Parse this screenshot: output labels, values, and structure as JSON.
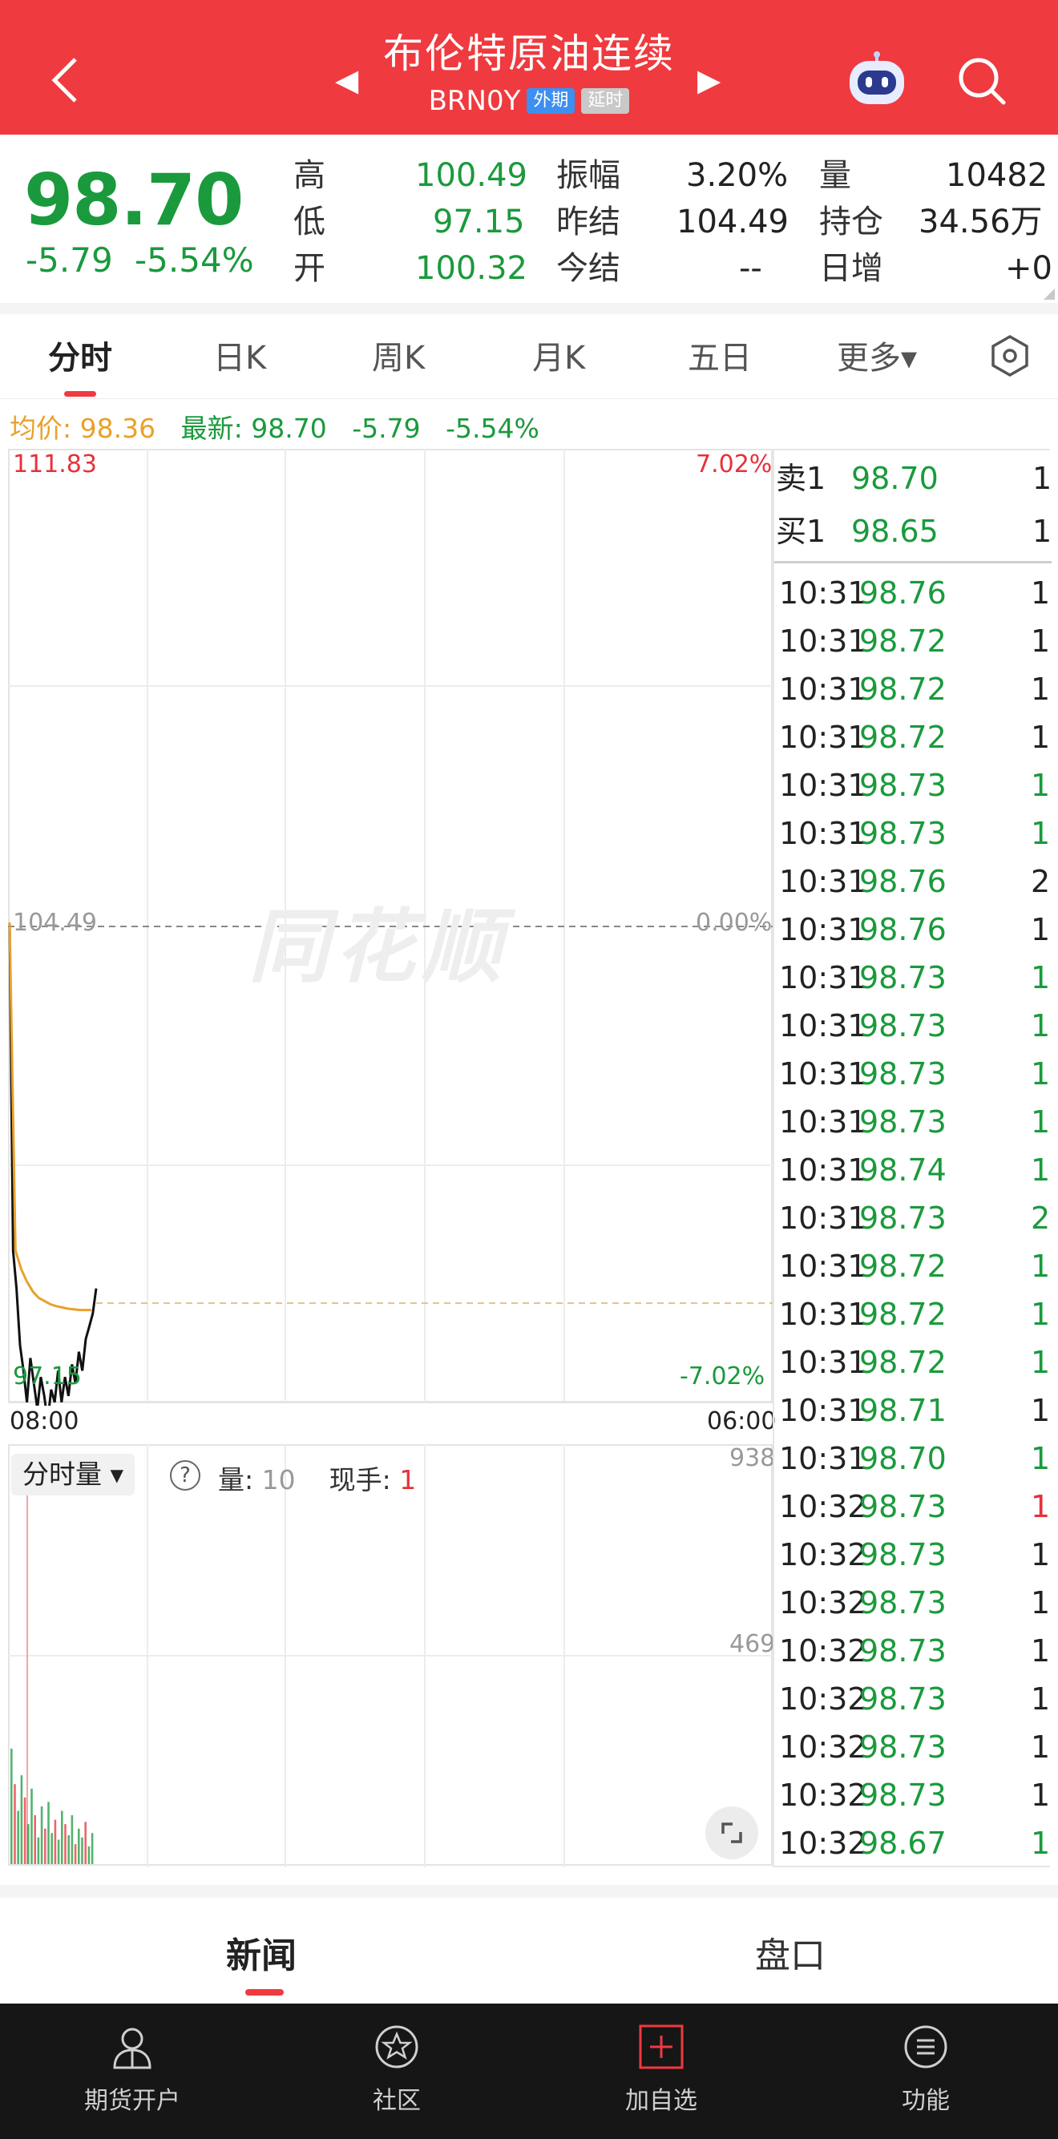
{
  "header": {
    "title": "布伦特原油连续",
    "code": "BRN0Y",
    "tag_foreign": "外期",
    "tag_delay": "延时",
    "arrow_left": "◀",
    "arrow_right": "▶"
  },
  "quote": {
    "price": "98.70",
    "change": "-5.79",
    "change_pct": "-5.54%",
    "high_label": "高",
    "high": "100.49",
    "low_label": "低",
    "low": "97.15",
    "open_label": "开",
    "open": "100.32",
    "amp_label": "振幅",
    "amp": "3.20%",
    "prev_settle_label": "昨结",
    "prev_settle": "104.49",
    "settle_label": "今结",
    "settle": "--",
    "vol_label": "量",
    "vol": "10482",
    "oi_label": "持仓",
    "oi": "34.56万",
    "oi_chg_label": "日增",
    "oi_chg": "+0"
  },
  "tabs": [
    {
      "label": "分时"
    },
    {
      "label": "日K"
    },
    {
      "label": "周K"
    },
    {
      "label": "月K"
    },
    {
      "label": "五日"
    },
    {
      "label": "更多▾"
    }
  ],
  "info_line": {
    "avg_label": "均价:",
    "avg": "98.36",
    "latest_label": "最新:",
    "latest": "98.70",
    "change": "-5.79",
    "change_pct": "-5.54%"
  },
  "chart_labels": {
    "y_top": "111.83",
    "y_mid": "104.49",
    "y_bottom": "97.15",
    "pct_top": "7.02%",
    "pct_mid": "0.00%",
    "pct_bottom": "-7.02%",
    "x_start": "08:00",
    "x_end": "06:00",
    "watermark": "同花顺",
    "vol_top": "938",
    "vol_mid": "469"
  },
  "volume_panel": {
    "selector": "分时量 ▾",
    "help": "?",
    "vol_label": "量:",
    "vol_value": "10",
    "hand_label": "现手:",
    "hand_value": "1"
  },
  "chart_data": {
    "type": "line",
    "series": [
      {
        "values": [
          104.49,
          99.3,
          98.7,
          97.8,
          97.4,
          96.9,
          97.6,
          97.2,
          96.8,
          97.3,
          97.0,
          96.6,
          97.1,
          96.9,
          97.4,
          96.9,
          97.3,
          97.0,
          97.5,
          97.2,
          97.7,
          97.4,
          97.9,
          98.1,
          98.3,
          98.7
        ]
      },
      {
        "values": [
          104.49,
          99.3,
          99.0,
          98.8,
          98.65,
          98.55,
          98.5,
          98.45,
          98.42,
          98.4,
          98.38,
          98.37,
          98.36,
          98.36,
          98.36
        ]
      }
    ],
    "ylim": [
      97.15,
      111.83
    ],
    "volumes": [
      260,
      180,
      120,
      200,
      150,
      90,
      170,
      110,
      60,
      130,
      80,
      140,
      70,
      100,
      55,
      120,
      90,
      65,
      110,
      45,
      80,
      60,
      95,
      40,
      70
    ]
  },
  "order_book": {
    "ask_label": "卖1",
    "ask_price": "98.70",
    "ask_vol": "1",
    "bid_label": "买1",
    "bid_price": "98.65",
    "bid_vol": "1"
  },
  "trades": [
    {
      "t": "10:31",
      "p": "98.76",
      "v": "1",
      "c": "dark"
    },
    {
      "t": "10:31",
      "p": "98.72",
      "v": "1",
      "c": "dark"
    },
    {
      "t": "10:31",
      "p": "98.72",
      "v": "1",
      "c": "dark"
    },
    {
      "t": "10:31",
      "p": "98.72",
      "v": "1",
      "c": "dark"
    },
    {
      "t": "10:31",
      "p": "98.73",
      "v": "1",
      "c": "green"
    },
    {
      "t": "10:31",
      "p": "98.73",
      "v": "1",
      "c": "green"
    },
    {
      "t": "10:31",
      "p": "98.76",
      "v": "2",
      "c": "dark"
    },
    {
      "t": "10:31",
      "p": "98.76",
      "v": "1",
      "c": "dark"
    },
    {
      "t": "10:31",
      "p": "98.73",
      "v": "1",
      "c": "green"
    },
    {
      "t": "10:31",
      "p": "98.73",
      "v": "1",
      "c": "green"
    },
    {
      "t": "10:31",
      "p": "98.73",
      "v": "1",
      "c": "green"
    },
    {
      "t": "10:31",
      "p": "98.73",
      "v": "1",
      "c": "green"
    },
    {
      "t": "10:31",
      "p": "98.74",
      "v": "1",
      "c": "green"
    },
    {
      "t": "10:31",
      "p": "98.73",
      "v": "2",
      "c": "green"
    },
    {
      "t": "10:31",
      "p": "98.72",
      "v": "1",
      "c": "green"
    },
    {
      "t": "10:31",
      "p": "98.72",
      "v": "1",
      "c": "green"
    },
    {
      "t": "10:31",
      "p": "98.72",
      "v": "1",
      "c": "green"
    },
    {
      "t": "10:31",
      "p": "98.71",
      "v": "1",
      "c": "dark"
    },
    {
      "t": "10:31",
      "p": "98.70",
      "v": "1",
      "c": "green"
    },
    {
      "t": "10:32",
      "p": "98.73",
      "v": "1",
      "c": "red"
    },
    {
      "t": "10:32",
      "p": "98.73",
      "v": "1",
      "c": "dark"
    },
    {
      "t": "10:32",
      "p": "98.73",
      "v": "1",
      "c": "dark"
    },
    {
      "t": "10:32",
      "p": "98.73",
      "v": "1",
      "c": "dark"
    },
    {
      "t": "10:32",
      "p": "98.73",
      "v": "1",
      "c": "dark"
    },
    {
      "t": "10:32",
      "p": "98.73",
      "v": "1",
      "c": "dark"
    },
    {
      "t": "10:32",
      "p": "98.73",
      "v": "1",
      "c": "dark"
    },
    {
      "t": "10:32",
      "p": "98.67",
      "v": "1",
      "c": "green"
    }
  ],
  "content_tabs": [
    {
      "label": "新闻"
    },
    {
      "label": "盘口"
    }
  ],
  "nav": [
    {
      "label": "期货开户",
      "icon": "user-icon"
    },
    {
      "label": "社区",
      "icon": "community-icon"
    },
    {
      "label": "加自选",
      "icon": "add-icon"
    },
    {
      "label": "功能",
      "icon": "menu-icon"
    }
  ],
  "colors": {
    "brand_red": "#ef3a3f",
    "down_green": "#1a9a3c",
    "avg_orange": "#e9a12a"
  }
}
